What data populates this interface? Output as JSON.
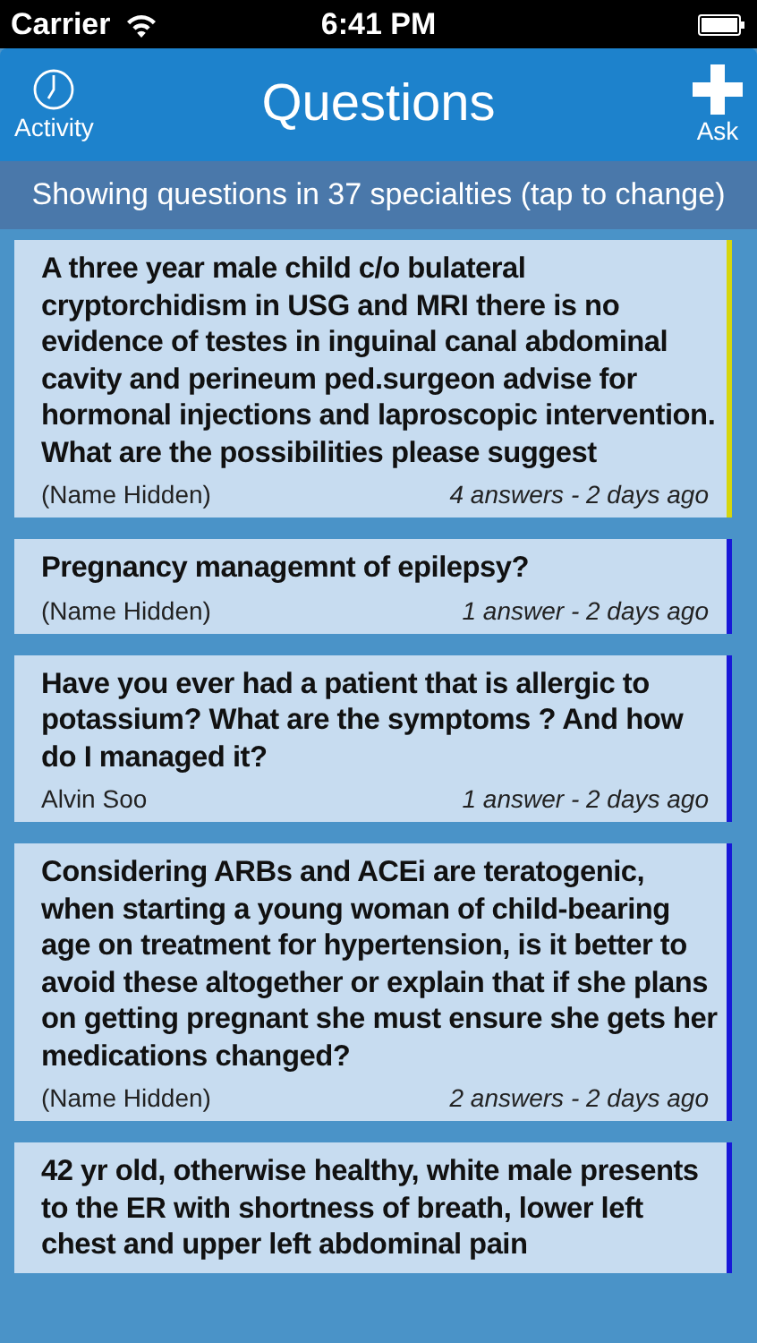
{
  "status_bar": {
    "carrier": "Carrier",
    "time": "6:41 PM"
  },
  "nav_bar": {
    "title": "Questions",
    "left_button": "Activity",
    "right_button": "Ask"
  },
  "filter_banner": "Showing questions in 37 specialties (tap to change)",
  "questions": [
    {
      "text": "A three year male child c/o  bulateral cryptorchidism in USG and MRI there is no evidence of testes in inguinal canal abdominal cavity and perineum ped.surgeon advise for hormonal injections and laproscopic intervention. What are the possibilities please suggest",
      "author": "(Name Hidden)",
      "meta": "4 answers - 2 days ago",
      "color": "#d6d60c"
    },
    {
      "text": "Pregnancy managemnt of epilepsy?",
      "author": "(Name Hidden)",
      "meta": "1 answer - 2 days ago",
      "color": "#1818d8"
    },
    {
      "text": "Have you ever had a patient that is allergic to potassium? What are the symptoms ? And how do I managed it?",
      "author": "Alvin Soo",
      "meta": "1 answer - 2 days ago",
      "color": "#1818d8"
    },
    {
      "text": "Considering ARBs and ACEi are teratogenic, when starting a young woman of child-bearing age on treatment for hypertension, is it better to avoid these altogether or explain that if she plans on getting pregnant she must ensure she gets her medications changed?",
      "author": "(Name Hidden)",
      "meta": "2 answers - 2 days ago",
      "color": "#1818d8"
    },
    {
      "text": "42 yr old, otherwise healthy, white male presents to the ER with shortness of breath, lower left chest and upper left abdominal pain",
      "color": "#1818d8"
    }
  ]
}
